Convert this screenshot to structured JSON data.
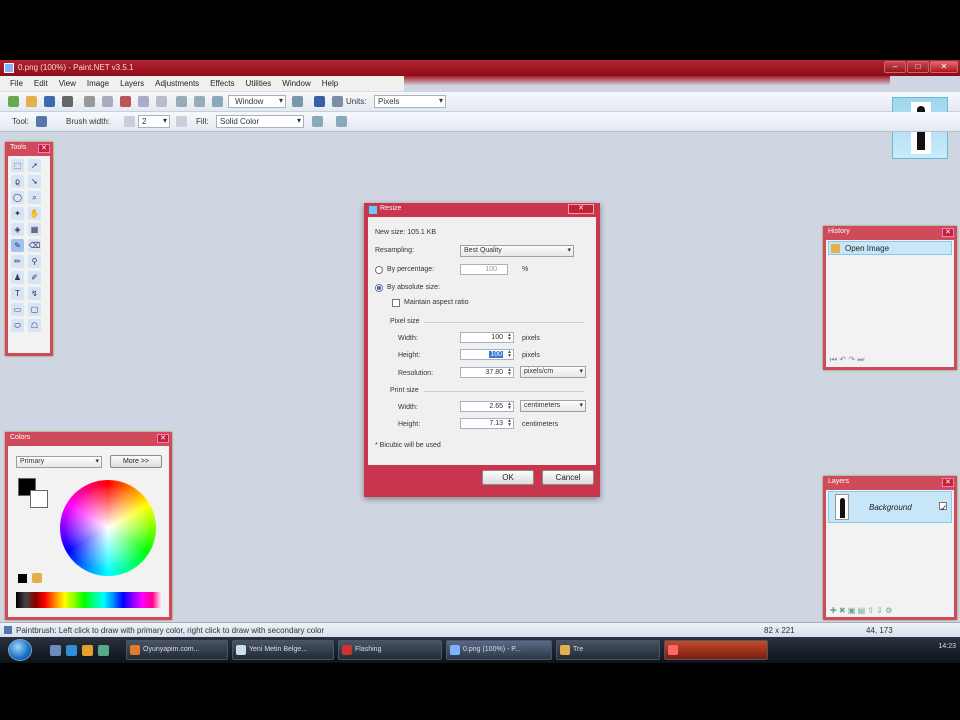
{
  "window": {
    "title": "0.png (100%) - Paint.NET v3.5.1"
  },
  "menu": [
    "File",
    "Edit",
    "View",
    "Image",
    "Layers",
    "Adjustments",
    "Effects",
    "Utilities",
    "Window",
    "Help"
  ],
  "toolbar1": {
    "window_combo": "Window",
    "units_label": "Units:",
    "units_value": "Pixels"
  },
  "toolbar2": {
    "tool_label": "Tool:",
    "brush_label": "Brush width:",
    "brush_value": "2",
    "fill_label": "Fill:",
    "fill_value": "Solid Color"
  },
  "tools_panel": {
    "title": "Tools"
  },
  "colors_panel": {
    "title": "Colors",
    "mode": "Primary",
    "more_button": "More >>"
  },
  "history_panel": {
    "title": "History",
    "item": "Open Image"
  },
  "layers_panel": {
    "title": "Layers",
    "layer_name": "Background"
  },
  "dialog": {
    "title": "Resize",
    "new_size": "New size: 105.1 KB",
    "resampling_label": "Resampling:",
    "resampling_value": "Best Quality",
    "by_percentage_label": "By percentage:",
    "percentage_value": "100",
    "percent_sign": "%",
    "by_absolute_label": "By absolute size:",
    "maintain_label": "Maintain aspect ratio",
    "pixel_size_label": "Pixel size",
    "width_label": "Width:",
    "width_value": "100",
    "width_unit": "pixels",
    "height_label": "Height:",
    "height_value": "100",
    "height_unit": "pixels",
    "resolution_label": "Resolution:",
    "resolution_value": "37.80",
    "resolution_unit": "pixels/cm",
    "print_size_label": "Print size",
    "print_width_label": "Width:",
    "print_width_value": "2.65",
    "print_width_unit": "centimeters",
    "print_height_label": "Height:",
    "print_height_value": "7.13",
    "print_height_unit": "centimeters",
    "bicubic_note": "* Bicubic will be used",
    "ok_button": "OK",
    "cancel_button": "Cancel"
  },
  "statusbar": {
    "hint": "Paintbrush: Left click to draw with primary color, right click to draw with secondary color",
    "size": "82 x 221",
    "coords": "44, 173"
  },
  "taskbar": {
    "items": [
      "Oyunyapim.com...",
      "Yeni Metin Belge...",
      "Flashing",
      "0.png (100%) - P...",
      "Tre"
    ],
    "tray_time": "14:23"
  },
  "colors": {
    "accent": "#c8354c",
    "workspace": "#cfd6e2"
  }
}
